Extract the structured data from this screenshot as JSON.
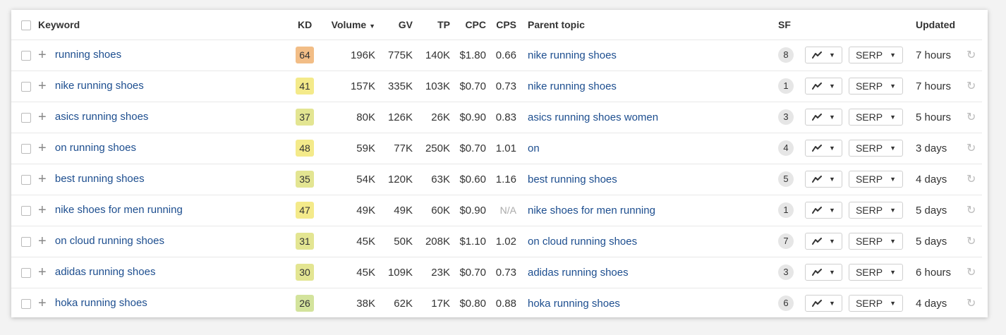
{
  "columns": {
    "keyword": "Keyword",
    "kd": "KD",
    "volume": "Volume",
    "gv": "GV",
    "tp": "TP",
    "cpc": "CPC",
    "cps": "CPS",
    "parent_topic": "Parent topic",
    "sf": "SF",
    "updated": "Updated"
  },
  "serp_label": "SERP",
  "kd_colors": {
    "64": "#f2bd86",
    "41": "#f4ea8a",
    "37": "#e3e592",
    "48": "#f4ea8a",
    "35": "#e3e592",
    "47": "#f4ea8a",
    "31": "#e3e592",
    "30": "#e3e592",
    "26": "#d3e39c"
  },
  "rows": [
    {
      "keyword": "running shoes",
      "kd": "64",
      "volume": "196K",
      "gv": "775K",
      "tp": "140K",
      "cpc": "$1.80",
      "cps": "0.66",
      "parent_topic": "nike running shoes",
      "sf": "8",
      "updated": "7 hours"
    },
    {
      "keyword": "nike running shoes",
      "kd": "41",
      "volume": "157K",
      "gv": "335K",
      "tp": "103K",
      "cpc": "$0.70",
      "cps": "0.73",
      "parent_topic": "nike running shoes",
      "sf": "1",
      "updated": "7 hours"
    },
    {
      "keyword": "asics running shoes",
      "kd": "37",
      "volume": "80K",
      "gv": "126K",
      "tp": "26K",
      "cpc": "$0.90",
      "cps": "0.83",
      "parent_topic": "asics running shoes women",
      "sf": "3",
      "updated": "5 hours"
    },
    {
      "keyword": "on running shoes",
      "kd": "48",
      "volume": "59K",
      "gv": "77K",
      "tp": "250K",
      "cpc": "$0.70",
      "cps": "1.01",
      "parent_topic": "on",
      "sf": "4",
      "updated": "3 days"
    },
    {
      "keyword": "best running shoes",
      "kd": "35",
      "volume": "54K",
      "gv": "120K",
      "tp": "63K",
      "cpc": "$0.60",
      "cps": "1.16",
      "parent_topic": "best running shoes",
      "sf": "5",
      "updated": "4 days"
    },
    {
      "keyword": "nike shoes for men running",
      "kd": "47",
      "volume": "49K",
      "gv": "49K",
      "tp": "60K",
      "cpc": "$0.90",
      "cps": "N/A",
      "parent_topic": "nike shoes for men running",
      "sf": "1",
      "updated": "5 days"
    },
    {
      "keyword": "on cloud running shoes",
      "kd": "31",
      "volume": "45K",
      "gv": "50K",
      "tp": "208K",
      "cpc": "$1.10",
      "cps": "1.02",
      "parent_topic": "on cloud running shoes",
      "sf": "7",
      "updated": "5 days"
    },
    {
      "keyword": "adidas running shoes",
      "kd": "30",
      "volume": "45K",
      "gv": "109K",
      "tp": "23K",
      "cpc": "$0.70",
      "cps": "0.73",
      "parent_topic": "adidas running shoes",
      "sf": "3",
      "updated": "6 hours"
    },
    {
      "keyword": "hoka running shoes",
      "kd": "26",
      "volume": "38K",
      "gv": "62K",
      "tp": "17K",
      "cpc": "$0.80",
      "cps": "0.88",
      "parent_topic": "hoka running shoes",
      "sf": "6",
      "updated": "4 days"
    }
  ]
}
